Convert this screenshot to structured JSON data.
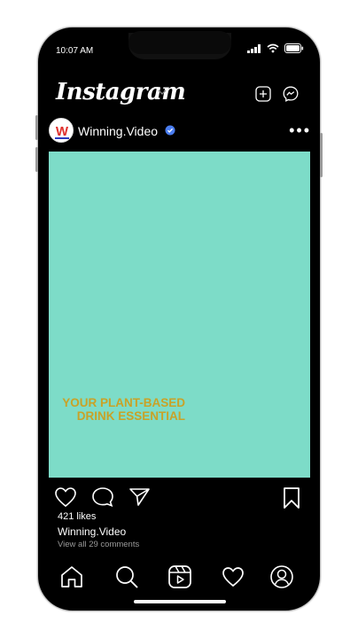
{
  "status_bar": {
    "time": "10:07 AM"
  },
  "header": {
    "app_name": "Instagram"
  },
  "post": {
    "author": "Winning.Video",
    "avatar_letter": "W",
    "media_bg": "#7ddcc8",
    "tagline_line1": "YOUR PLANT-BASED",
    "tagline_line2": "DRINK ESSENTIAL",
    "likes": "421 likes",
    "caption_user": "Winning.Video",
    "comments_link": "View all 29 comments"
  },
  "icons": {
    "header": [
      "new-post-icon",
      "messenger-icon"
    ],
    "actions": [
      "heart-icon",
      "comment-icon",
      "share-icon",
      "bookmark-icon"
    ],
    "tabbar": [
      "home-icon",
      "search-icon",
      "reels-icon",
      "activity-icon",
      "profile-icon"
    ]
  },
  "colors": {
    "accent_verified": "#4a7df0",
    "tagline": "#c9a227",
    "brand_red": "#e0312d",
    "brand_blue": "#2b3bbf"
  }
}
